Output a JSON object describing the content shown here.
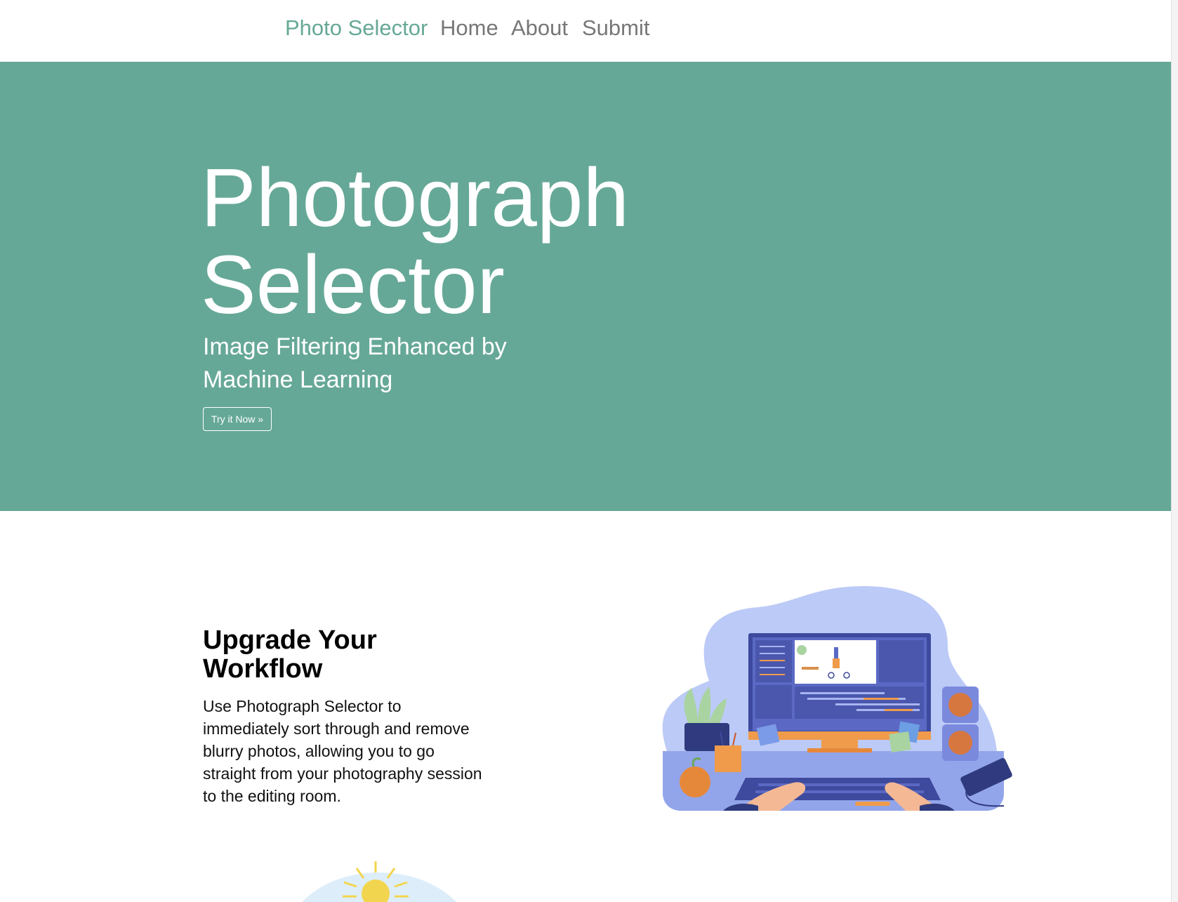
{
  "nav": {
    "brand": "Photo Selector",
    "links": [
      "Home",
      "About",
      "Submit"
    ]
  },
  "hero": {
    "title": "Photograph Selector",
    "subtitle": "Image Filtering Enhanced by Machine Learning",
    "cta_label": "Try it Now »"
  },
  "feature": {
    "title": "Upgrade Your Workflow",
    "body": "Use Photograph Selector to immediately sort through and remove blurry photos, allowing you to go straight from your photography session to the editing room.",
    "illustration_icon": "desk-computer-editing-illustration"
  },
  "next_feature": {
    "illustration_icon": "sun-sky-illustration"
  },
  "colors": {
    "accent": "#66a897",
    "nav_text": "#777777",
    "hero_text": "#ffffff",
    "illustration_blob": "#bccaf7",
    "illustration_monitor": "#3e4a9e",
    "illustration_orange": "#ef9b4b"
  }
}
